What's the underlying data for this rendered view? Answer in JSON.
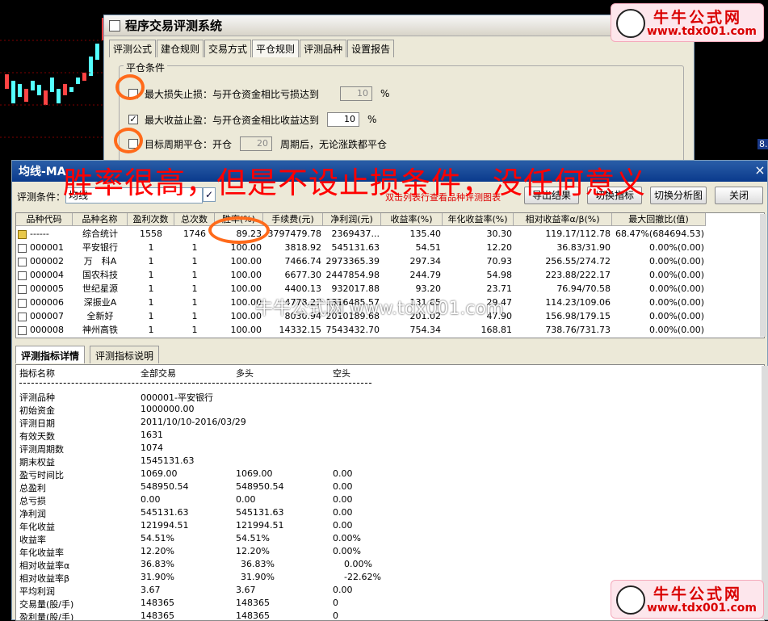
{
  "back_dialog": {
    "title": "程序交易评测系统",
    "tabs": [
      "评测公式",
      "建仓规则",
      "交易方式",
      "平仓规则",
      "评测品种",
      "设置报告"
    ],
    "active_tab": 3,
    "group_title": "平仓条件",
    "rows": [
      {
        "checked": false,
        "label": "最大损失止损：与开仓资金相比亏损达到",
        "value": "10",
        "unit": "%",
        "disabled": true
      },
      {
        "checked": true,
        "label": "最大收益止盈：与开仓资金相比收益达到",
        "value": "10",
        "unit": "%",
        "disabled": false
      },
      {
        "checked": false,
        "label": "目标周期平仓：开仓",
        "value": "20",
        "unit": "周期后，无论涨跌都平仓",
        "disabled": true
      }
    ]
  },
  "window": {
    "title": "均线-MA",
    "close": "×",
    "condition_label": "评测条件：",
    "condition_value": "均线",
    "hint": "双击列表行查看品种评测图表",
    "buttons": [
      "导出结果",
      "切换指标",
      "切换分析图",
      "关闭"
    ]
  },
  "headline": "胜率很高，但是不设止损条件，没任何意义",
  "table": {
    "headers": [
      "品种代码",
      "品种名称",
      "盈利次数",
      "总次数",
      "胜率(%)",
      "手续费(元)",
      "净利润(元)",
      "收益率(%)",
      "年化收益率(%)",
      "相对收益率α/β(%)",
      "最大回撤比(值)"
    ],
    "rows": [
      [
        "------",
        "综合统计",
        "1558",
        "1746",
        "89.23",
        "3797479.78",
        "2369437...",
        "135.40",
        "30.30",
        "119.17/112.78",
        "68.47%(684694.53)"
      ],
      [
        "000001",
        "平安银行",
        "1",
        "1",
        "100.00",
        "3818.92",
        "545131.63",
        "54.51",
        "12.20",
        "36.83/31.90",
        "0.00%(0.00)"
      ],
      [
        "000002",
        "万　科A",
        "1",
        "1",
        "100.00",
        "7466.74",
        "2973365.39",
        "297.34",
        "70.93",
        "256.55/274.72",
        "0.00%(0.00)"
      ],
      [
        "000004",
        "国农科技",
        "1",
        "1",
        "100.00",
        "6677.30",
        "2447854.98",
        "244.79",
        "54.98",
        "223.88/222.17",
        "0.00%(0.00)"
      ],
      [
        "000005",
        "世纪星源",
        "1",
        "1",
        "100.00",
        "4400.13",
        "932017.88",
        "93.20",
        "23.71",
        "76.94/70.58",
        "0.00%(0.00)"
      ],
      [
        "000006",
        "深振业A",
        "1",
        "1",
        "100.00",
        "4778.27",
        "1316485.57",
        "131.65",
        "29.47",
        "114.23/109.06",
        "0.00%(0.00)"
      ],
      [
        "000007",
        "全新好",
        "1",
        "1",
        "100.00",
        "8030.94",
        "2010189.68",
        "201.02",
        "47.90",
        "156.98/179.15",
        "0.00%(0.00)"
      ],
      [
        "000008",
        "神州高铁",
        "1",
        "1",
        "100.00",
        "14332.15",
        "7543432.70",
        "754.34",
        "168.81",
        "738.76/731.73",
        "0.00%(0.00)"
      ]
    ]
  },
  "lower_tabs": [
    "评测指标详情",
    "评测指标说明"
  ],
  "detail": {
    "headers": [
      "指标名称",
      "全部交易",
      "多头",
      "空头"
    ],
    "rows": [
      [
        "评测品种",
        "000001-平安银行",
        "",
        ""
      ],
      [
        "初始资金",
        "1000000.00",
        "",
        ""
      ],
      [
        "评测日期",
        "2011/10/10-2016/03/29",
        "",
        ""
      ],
      [
        "有效天数",
        "1631",
        "",
        ""
      ],
      [
        "评测周期数",
        "1074",
        "",
        ""
      ],
      [
        "期末权益",
        "1545131.63",
        "",
        ""
      ],
      [
        "盈亏时间比",
        "1069.00",
        "1069.00",
        "0.00"
      ],
      [
        "总盈利",
        "548950.54",
        "548950.54",
        "0.00"
      ],
      [
        "总亏损",
        "0.00",
        "0.00",
        "0.00"
      ],
      [
        "净利润",
        "545131.63",
        "545131.63",
        "0.00"
      ],
      [
        "年化收益",
        "121994.51",
        "121994.51",
        "0.00"
      ],
      [
        "收益率",
        "54.51%",
        "54.51%",
        "0.00%"
      ],
      [
        "年化收益率",
        "12.20%",
        "12.20%",
        "0.00%"
      ],
      [
        "相对收益率α",
        "36.83%",
        "36.83%",
        "0.00%"
      ],
      [
        "相对收益率β",
        "31.90%",
        "31.90%",
        "-22.62%"
      ],
      [
        "平均利润",
        "3.67",
        "3.67",
        "0.00"
      ],
      [
        "交易量(股/手)",
        "148365",
        "148365",
        "0"
      ],
      [
        "盈利量(股/手)",
        "148365",
        "148365",
        "0"
      ]
    ]
  },
  "watermark": "牛牛公式网 www.tdx001.com",
  "logo": {
    "name": "牛牛公式网",
    "url": "www.tdx001.com"
  },
  "side_value": "8.",
  "colors": {
    "accent_red": "#ff0000",
    "ring_orange": "#ff6a1a",
    "title_blue": "#0a3a8c"
  }
}
